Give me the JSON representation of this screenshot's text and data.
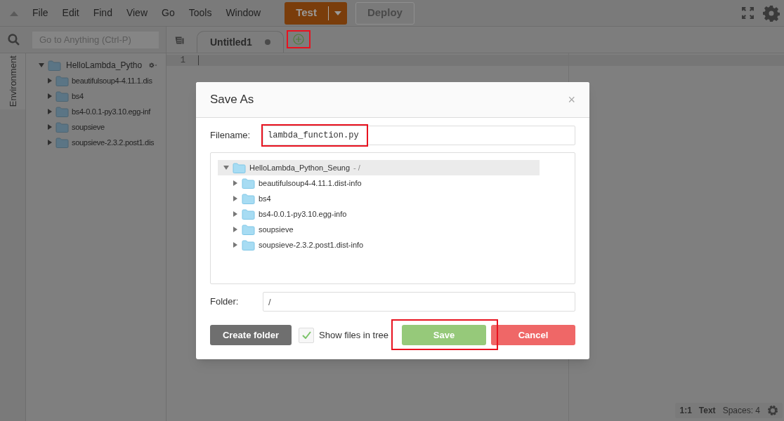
{
  "menu": [
    "File",
    "Edit",
    "Find",
    "View",
    "Go",
    "Tools",
    "Window"
  ],
  "run_button": {
    "label": "Test"
  },
  "deploy_button": {
    "label": "Deploy",
    "disabled": true
  },
  "search": {
    "placeholder": "Go to Anything (Ctrl-P)"
  },
  "side_tab": {
    "label": "Environment"
  },
  "tree": {
    "name": "HelloLambda_Pytho",
    "expanded": true,
    "children": [
      {
        "name": "beautifulsoup4-4.11.1.dis",
        "expanded": false
      },
      {
        "name": "bs4",
        "expanded": false
      },
      {
        "name": "bs4-0.0.1-py3.10.egg-inf",
        "expanded": false
      },
      {
        "name": "soupsieve",
        "expanded": false
      },
      {
        "name": "soupsieve-2.3.2.post1.dis",
        "expanded": false
      }
    ]
  },
  "tabs": [
    {
      "label": "Untitled1",
      "selected": true,
      "unsaved": true
    }
  ],
  "new_tab_button": {
    "highlighted": true
  },
  "line_numbers": [
    "1"
  ],
  "status_bar": [
    "1:1",
    "Text",
    "Spaces: 4"
  ],
  "dialog": {
    "title": "Save As",
    "close": "×",
    "filename": {
      "label": "Filename:",
      "value": "lambda_function.py",
      "highlighted": true
    },
    "tree": {
      "name": "HelloLambda_Python_Seung",
      "path": "- /",
      "expanded": true,
      "selected": true,
      "children": [
        {
          "name": "beautifulsoup4-4.11.1.dist-info",
          "expanded": false
        },
        {
          "name": "bs4",
          "expanded": false
        },
        {
          "name": "bs4-0.0.1-py3.10.egg-info",
          "expanded": false
        },
        {
          "name": "soupsieve",
          "expanded": false
        },
        {
          "name": "soupsieve-2.3.2.post1.dist-info",
          "expanded": false
        }
      ]
    },
    "folder": {
      "label": "Folder:",
      "value": "/"
    },
    "create_folder_button": {
      "label": "Create folder"
    },
    "show_files": {
      "label": "Show files in tree",
      "checked": true
    },
    "save_button": {
      "label": "Save",
      "highlighted": true
    },
    "cancel_button": {
      "label": "Cancel"
    }
  }
}
